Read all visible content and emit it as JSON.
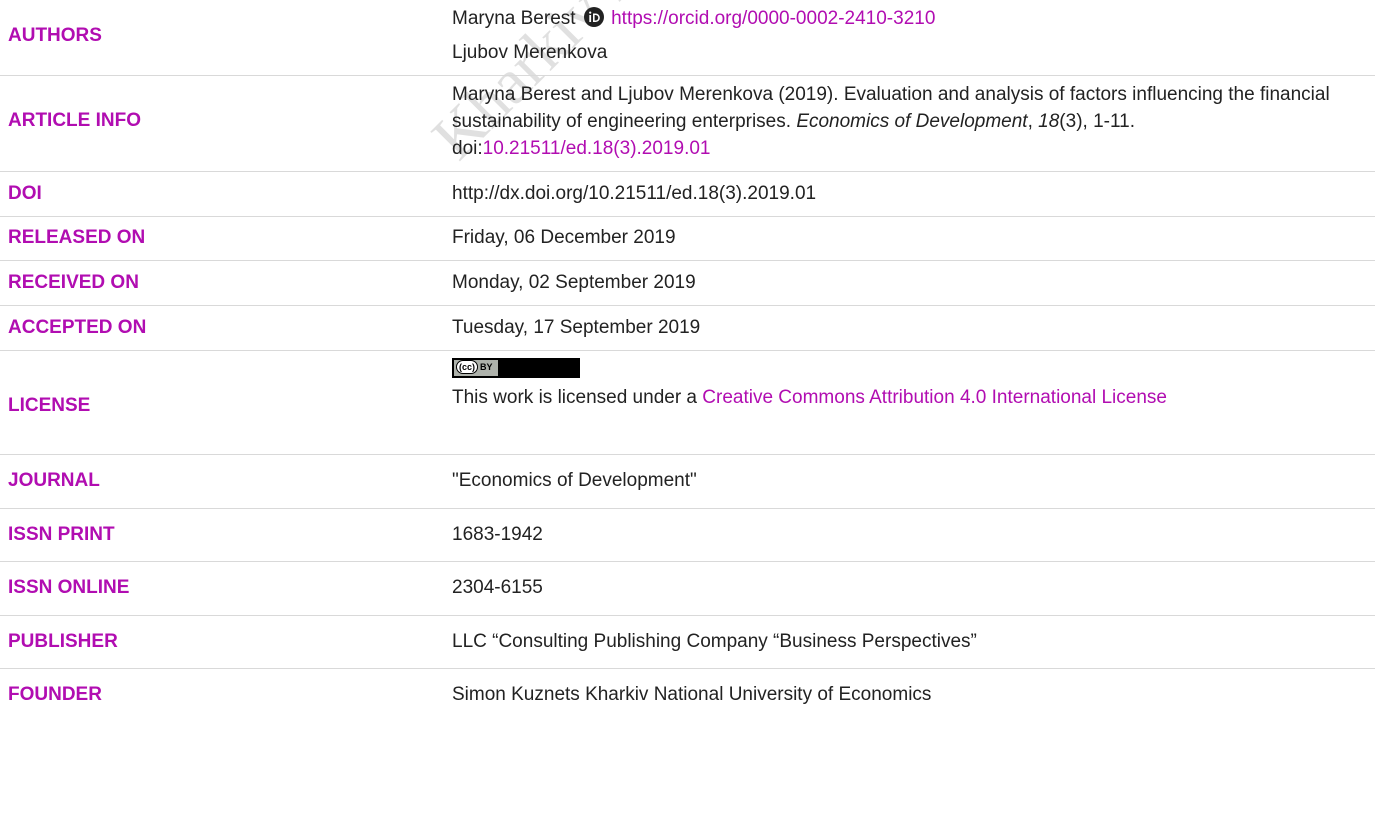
{
  "rows": {
    "authors": {
      "label": "AUTHORS",
      "author1_name": "Maryna Berest",
      "author1_orcid": "https://orcid.org/0000-0002-2410-3210",
      "author2_name": "Ljubov Merenkova"
    },
    "article_info": {
      "label": "ARTICLE INFO",
      "citation_prefix": "Maryna Berest and Ljubov Merenkova (2019). Evaluation and analysis of factors influencing the financial sustainability of engineering enterprises. ",
      "journal_italic": "Economics of Development",
      "comma1": ", ",
      "volume_italic": "18",
      "issue_pages": "(3), 1-11. doi:",
      "doi_link": "10.21511/ed.18(3).2019.01"
    },
    "doi": {
      "label": "DOI",
      "value": "http://dx.doi.org/10.21511/ed.18(3).2019.01"
    },
    "released": {
      "label": "RELEASED ON",
      "value": "Friday, 06 December 2019"
    },
    "received": {
      "label": "RECEIVED ON",
      "value": "Monday, 02 September 2019"
    },
    "accepted": {
      "label": "ACCEPTED ON",
      "value": "Tuesday, 17 September 2019"
    },
    "license": {
      "label": "LICENSE",
      "badge_cc": "(cc)",
      "badge_by": "BY",
      "text_prefix": "This work is licensed under a ",
      "link_text": "Creative Commons Attribution 4.0 International License"
    },
    "journal": {
      "label": "JOURNAL",
      "value": "\"Economics of Development\""
    },
    "issn_print": {
      "label": "ISSN PRINT",
      "value": "1683-1942"
    },
    "issn_online": {
      "label": "ISSN ONLINE",
      "value": "2304-6155"
    },
    "publisher": {
      "label": "PUBLISHER",
      "value": "LLC “Consulting Publishing Company “Business Perspectives”"
    },
    "founder": {
      "label": "FOUNDER",
      "value": "Simon Kuznets Kharkiv National University of Economics"
    }
  },
  "watermark": "Kharkiv National University of Economics",
  "colors": {
    "accent": "#b10db1",
    "text": "#222222",
    "divider": "#d9d9d9"
  },
  "icons": {
    "orcid": "orcid-icon",
    "license_badge": "cc-by-badge"
  }
}
